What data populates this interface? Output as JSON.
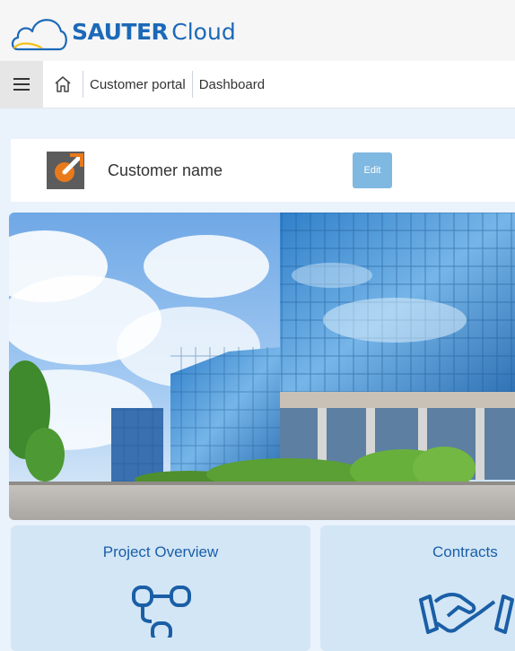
{
  "header": {
    "brand": "SAUTER",
    "product": "Cloud"
  },
  "navbar": {
    "breadcrumbs": [
      "Customer portal",
      "Dashboard"
    ]
  },
  "customer": {
    "name": "Customer name",
    "edit_label": "Edit"
  },
  "tiles": [
    {
      "title": "Project Overview",
      "icon": "network-icon"
    },
    {
      "title": "Contracts",
      "icon": "handshake-icon"
    }
  ],
  "colors": {
    "brand_blue": "#1c69b8",
    "edit_button": "#7fb8e0",
    "tile_background": "#d3e6f6",
    "page_background": "#eaf2fc",
    "customer_logo_orange": "#e97a1b",
    "customer_logo_gray": "#5c5c5c"
  }
}
